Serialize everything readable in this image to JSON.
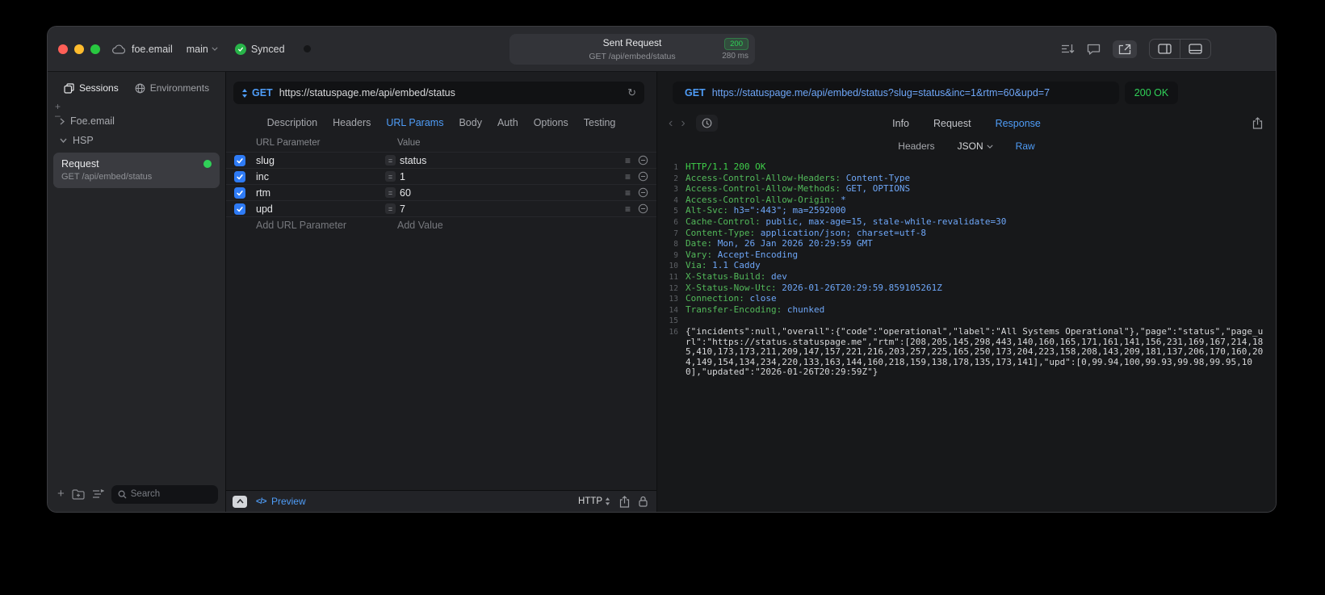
{
  "colors": {
    "accent": "#4f9df8",
    "green": "#30d158",
    "key_green": "#53b95a",
    "status_green": "#3fcf4a",
    "value_blue": "#6ea6f7",
    "body_text": "#d7d8da"
  },
  "titlebar": {
    "project": "foe.email",
    "branch": "main",
    "sync_status": "Synced",
    "request_summary": {
      "title": "Sent Request",
      "status_code": "200",
      "method_path": "GET /api/embed/status",
      "duration": "280 ms"
    }
  },
  "sidebar": {
    "tabs": [
      {
        "label": "Sessions"
      },
      {
        "label": "Environments"
      }
    ],
    "tree": [
      {
        "label": "Foe.email"
      },
      {
        "label": "HSP"
      }
    ],
    "request_item": {
      "title": "Request",
      "subtitle": "GET /api/embed/status"
    },
    "search_placeholder": "Search"
  },
  "request": {
    "method": "GET",
    "url": "https://statuspage.me/api/embed/status",
    "tabs": [
      "Description",
      "Headers",
      "URL Params",
      "Body",
      "Auth",
      "Options",
      "Testing"
    ],
    "active_tab": "URL Params",
    "params": {
      "col_key": "URL Parameter",
      "col_value": "Value",
      "rows": [
        {
          "key": "slug",
          "value": "status",
          "checked": true
        },
        {
          "key": "inc",
          "value": "1",
          "checked": true
        },
        {
          "key": "rtm",
          "value": "60",
          "checked": true
        },
        {
          "key": "upd",
          "value": "7",
          "checked": true
        }
      ],
      "add_key": "Add URL Parameter",
      "add_value": "Add Value"
    },
    "footer": {
      "code_icon": "</>",
      "preview": "Preview",
      "protocol": "HTTP"
    }
  },
  "response": {
    "method": "GET",
    "url": "https://statuspage.me/api/embed/status?slug=status&inc=1&rtm=60&upd=7",
    "status": "200 OK",
    "tabs": [
      "Info",
      "Request",
      "Response"
    ],
    "active_tab": "Response",
    "subtabs": [
      "Headers",
      "JSON",
      "Raw"
    ],
    "active_subtab": "Raw",
    "dropdown_subtab": "JSON",
    "lines": [
      {
        "n": "1",
        "status": "HTTP/1.1 200 OK"
      },
      {
        "n": "2",
        "key": "Access-Control-Allow-Headers",
        "value": "Content-Type"
      },
      {
        "n": "3",
        "key": "Access-Control-Allow-Methods",
        "value": "GET, OPTIONS"
      },
      {
        "n": "4",
        "key": "Access-Control-Allow-Origin",
        "value": "*"
      },
      {
        "n": "5",
        "key": "Alt-Svc",
        "value": "h3=\":443\"; ma=2592000"
      },
      {
        "n": "6",
        "key": "Cache-Control",
        "value": "public, max-age=15, stale-while-revalidate=30"
      },
      {
        "n": "7",
        "key": "Content-Type",
        "value": "application/json; charset=utf-8"
      },
      {
        "n": "8",
        "key": "Date",
        "value": "Mon, 26 Jan 2026 20:29:59 GMT"
      },
      {
        "n": "9",
        "key": "Vary",
        "value": "Accept-Encoding"
      },
      {
        "n": "10",
        "key": "Via",
        "value": "1.1 Caddy"
      },
      {
        "n": "11",
        "key": "X-Status-Build",
        "value": "dev"
      },
      {
        "n": "12",
        "key": "X-Status-Now-Utc",
        "value": "2026-01-26T20:29:59.859105261Z"
      },
      {
        "n": "13",
        "key": "Connection",
        "value": "close"
      },
      {
        "n": "14",
        "key": "Transfer-Encoding",
        "value": "chunked"
      },
      {
        "n": "15",
        "empty": true
      },
      {
        "n": "16",
        "body": "{\"incidents\":null,\"overall\":{\"code\":\"operational\",\"label\":\"All Systems Operational\"},\"page\":\"status\",\"page_url\":\"https://status.statuspage.me\",\"rtm\":[208,205,145,298,443,140,160,165,171,161,141,156,231,169,167,214,185,410,173,173,211,209,147,157,221,216,203,257,225,165,250,173,204,223,158,208,143,209,181,137,206,170,160,204,149,154,134,234,220,133,163,144,160,218,159,138,178,135,173,141],\"upd\":[0,99.94,100,99.93,99.98,99.95,100],\"updated\":\"2026-01-26T20:29:59Z\"}"
      }
    ]
  }
}
